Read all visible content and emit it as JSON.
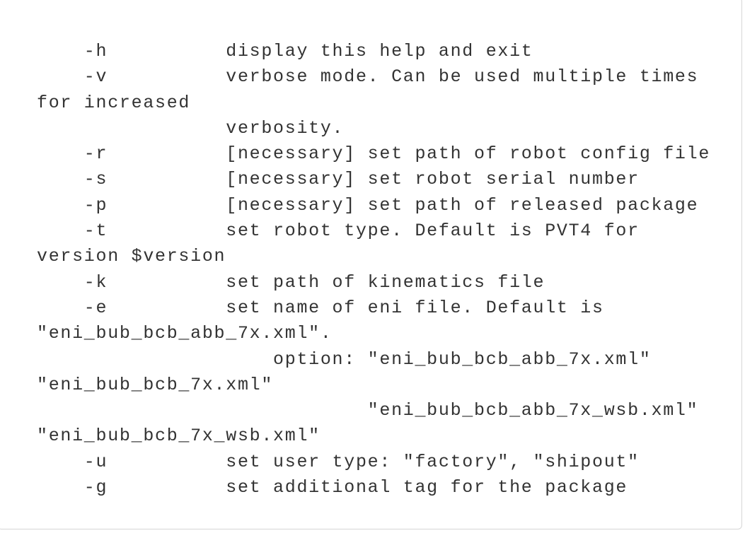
{
  "code_block": {
    "lines": [
      "    -h          display this help and exit",
      "    -v          verbose mode. Can be used multiple times",
      "for increased",
      "                verbosity.",
      "    -r          [necessary] set path of robot config file",
      "    -s          [necessary] set robot serial number",
      "    -p          [necessary] set path of released package",
      "    -t          set robot type. Default is PVT4 for",
      "version $version",
      "    -k          set path of kinematics file",
      "    -e          set name of eni file. Default is",
      "\"eni_bub_bcb_abb_7x.xml\".",
      "                    option: \"eni_bub_bcb_abb_7x.xml\"",
      "\"eni_bub_bcb_7x.xml\"",
      "                            \"eni_bub_bcb_abb_7x_wsb.xml\"",
      "\"eni_bub_bcb_7x_wsb.xml\"",
      "    -u          set user type: \"factory\", \"shipout\"",
      "    -g          set additional tag for the package"
    ]
  }
}
